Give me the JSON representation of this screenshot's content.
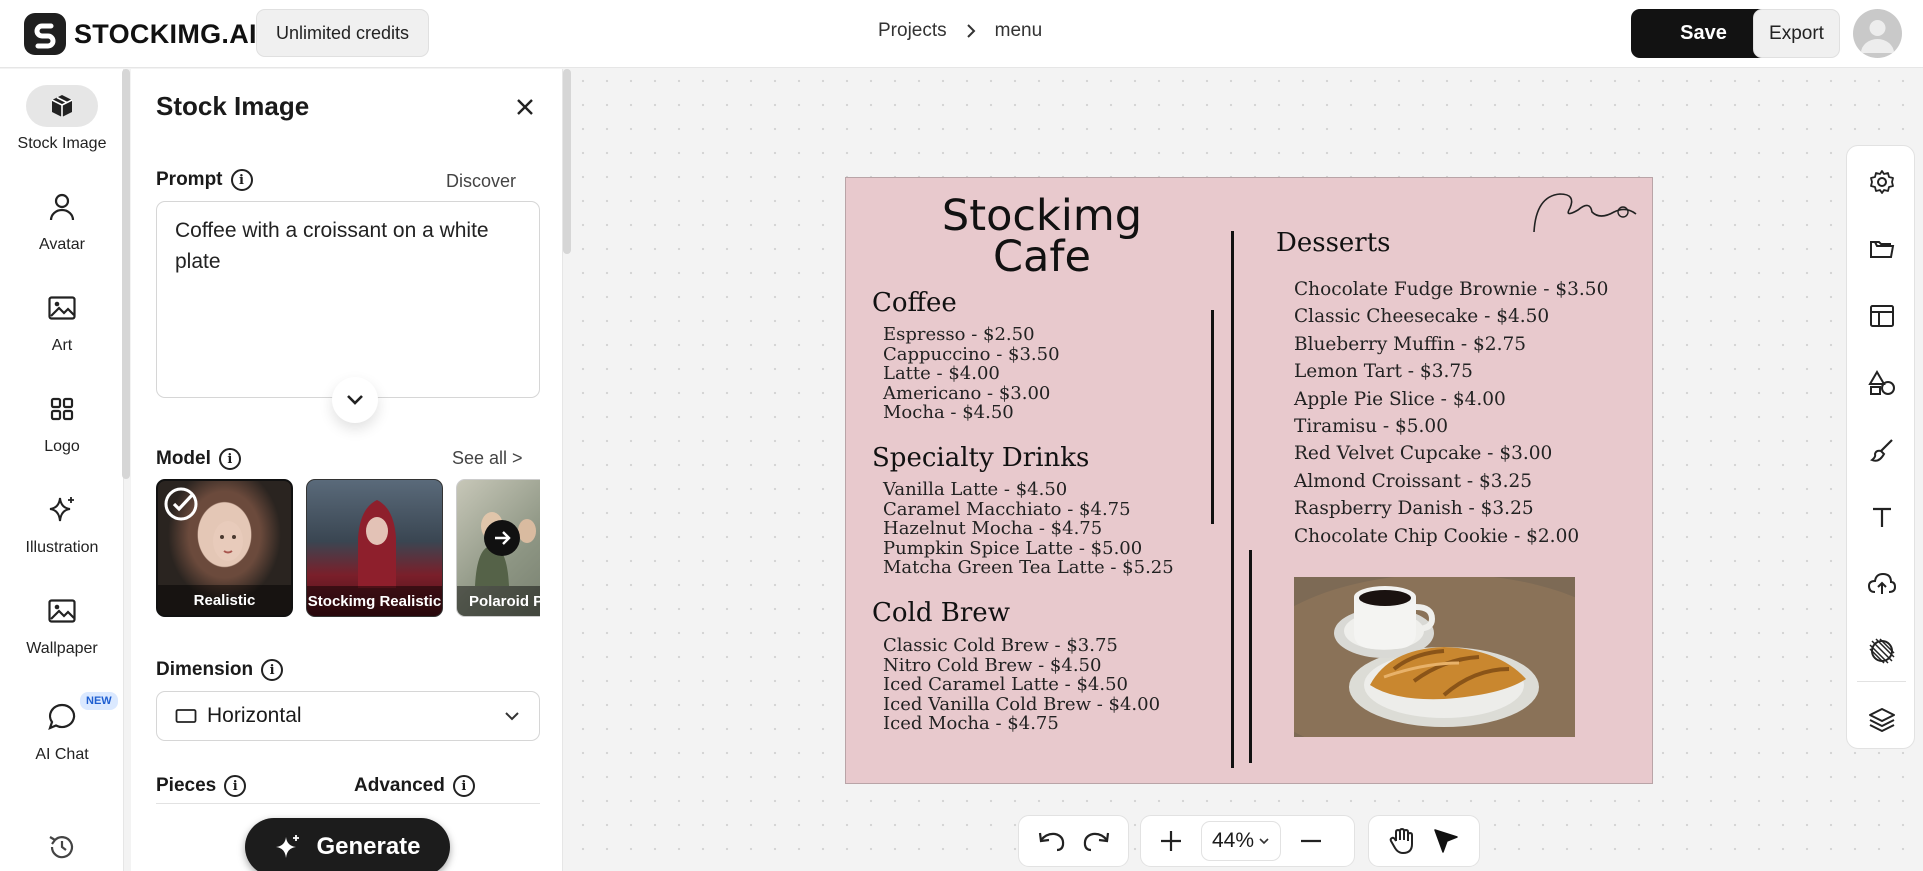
{
  "brand": {
    "name": "STOCKIMG.AI"
  },
  "header": {
    "credits": "Unlimited credits",
    "breadcrumb": {
      "projects": "Projects",
      "current": "menu"
    },
    "save": "Save",
    "export": "Export"
  },
  "rail": {
    "items": [
      {
        "label": "Stock Image",
        "icon": "cube-icon",
        "active": true
      },
      {
        "label": "Avatar",
        "icon": "person-icon"
      },
      {
        "label": "Art",
        "icon": "image-icon"
      },
      {
        "label": "Logo",
        "icon": "grid-icon"
      },
      {
        "label": "Illustration",
        "icon": "sparkle-icon"
      },
      {
        "label": "Wallpaper",
        "icon": "image-icon"
      },
      {
        "label": "AI Chat",
        "icon": "chat-bubble-icon",
        "badge": "NEW"
      }
    ]
  },
  "panel": {
    "title": "Stock Image",
    "prompt": {
      "label": "Prompt",
      "discover": "Discover",
      "value": "Coffee with a croissant on a white plate"
    },
    "model": {
      "label": "Model",
      "see_all": "See all >",
      "cards": [
        {
          "caption": "Realistic",
          "selected": true
        },
        {
          "caption": "Stockimg Realistic"
        },
        {
          "caption": "Polaroid P"
        }
      ]
    },
    "dimension": {
      "label": "Dimension",
      "value": "Horizontal"
    },
    "pieces": {
      "label": "Pieces"
    },
    "advanced": {
      "label": "Advanced"
    },
    "generate": "Generate"
  },
  "menu_design": {
    "title_line1": "Stockimg",
    "title_line2": "Cafe",
    "sections": [
      {
        "heading": "Coffee",
        "items": [
          "Espresso - $2.50",
          "Cappuccino - $3.50",
          "Latte - $4.00",
          "Americano - $3.00",
          "Mocha - $4.50"
        ]
      },
      {
        "heading": "Specialty Drinks",
        "items": [
          "Vanilla Latte - $4.50",
          "Caramel Macchiato - $4.75",
          "Hazelnut Mocha - $4.75",
          "Pumpkin Spice Latte - $5.00",
          "Matcha Green Tea Latte - $5.25"
        ]
      },
      {
        "heading": "Cold Brew",
        "items": [
          "Classic Cold Brew - $3.75",
          "Nitro Cold Brew - $4.50",
          "Iced Caramel Latte - $4.50",
          "Iced Vanilla Cold Brew - $4.00",
          "Iced Mocha - $4.75"
        ]
      }
    ],
    "desserts": {
      "heading": "Desserts",
      "items": [
        "Chocolate Fudge Brownie - $3.50",
        "Classic Cheesecake - $4.50",
        "Blueberry Muffin - $2.75",
        "Lemon Tart - $3.75",
        "Apple Pie Slice - $4.00",
        "Tiramisu - $5.00",
        "Red Velvet Cupcake - $3.00",
        "Almond Croissant - $3.25",
        "Raspberry Danish - $3.25",
        "Chocolate Chip Cookie - $2.00"
      ]
    },
    "background_color": "#e8c9cd"
  },
  "zoom": {
    "value": "44%"
  },
  "colors": {
    "accent": "#121212",
    "canvas_bg": "#f3f3f3"
  }
}
